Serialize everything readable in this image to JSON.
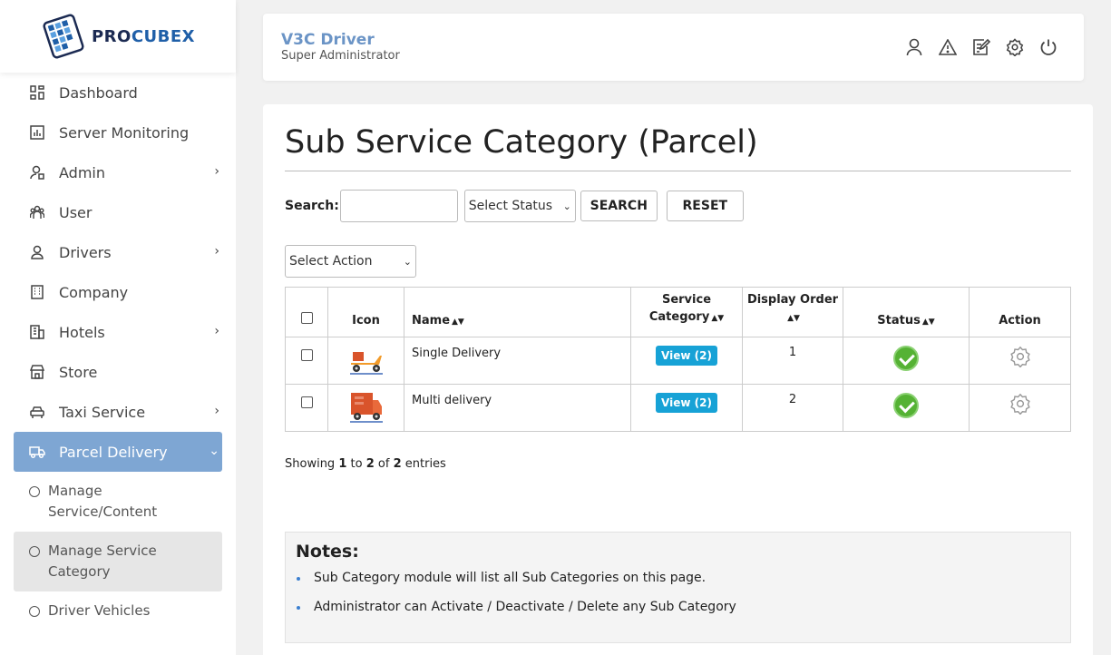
{
  "brand": {
    "pro": "PRO",
    "cubex": "CUBEX"
  },
  "sidebar": {
    "items": [
      {
        "label": "Dashboard",
        "icon": "dashboard-icon",
        "has_children": false
      },
      {
        "label": "Server Monitoring",
        "icon": "chart-icon",
        "has_children": false
      },
      {
        "label": "Admin",
        "icon": "admin-icon",
        "has_children": true
      },
      {
        "label": "User",
        "icon": "users-icon",
        "has_children": false
      },
      {
        "label": "Drivers",
        "icon": "driver-icon",
        "has_children": true
      },
      {
        "label": "Company",
        "icon": "building-icon",
        "has_children": false
      },
      {
        "label": "Hotels",
        "icon": "hotel-icon",
        "has_children": true
      },
      {
        "label": "Store",
        "icon": "store-icon",
        "has_children": false
      },
      {
        "label": "Taxi Service",
        "icon": "car-icon",
        "has_children": true
      },
      {
        "label": "Parcel Delivery",
        "icon": "truck-icon",
        "has_children": true,
        "active": true
      }
    ],
    "sub_items": [
      {
        "label": "Manage Service/Content"
      },
      {
        "label": "Manage Service Category",
        "selected": true
      },
      {
        "label": "Driver Vehicles"
      }
    ]
  },
  "header": {
    "title": "V3C Driver",
    "subtitle": "Super Administrator",
    "icons": [
      "user-icon",
      "warning-icon",
      "edit-icon",
      "settings-icon",
      "power-icon"
    ]
  },
  "main": {
    "title": "Sub Service Category (Parcel)",
    "search_label": "Search:",
    "search_value": "",
    "status_select": "Select Status",
    "search_button": "SEARCH",
    "reset_button": "RESET",
    "action_select": "Select Action",
    "table": {
      "headers": {
        "icon": "Icon",
        "name": "Name",
        "service_category_1": "Service",
        "service_category_2": "Category",
        "display_order": "Display Order",
        "status": "Status",
        "action": "Action"
      },
      "rows": [
        {
          "name": "Single Delivery",
          "view": "View (2)",
          "order": "1"
        },
        {
          "name": "Multi delivery",
          "view": "View (2)",
          "order": "2"
        }
      ]
    },
    "showing": {
      "prefix": "Showing",
      "from": "1",
      "to_word": "to",
      "to": "2",
      "of_word": "of",
      "total": "2",
      "suffix": "entries"
    },
    "notes": {
      "title": "Notes:",
      "items": [
        "Sub Category module will list all Sub Categories on this page.",
        "Administrator can Activate / Deactivate / Delete any Sub Category"
      ]
    }
  }
}
